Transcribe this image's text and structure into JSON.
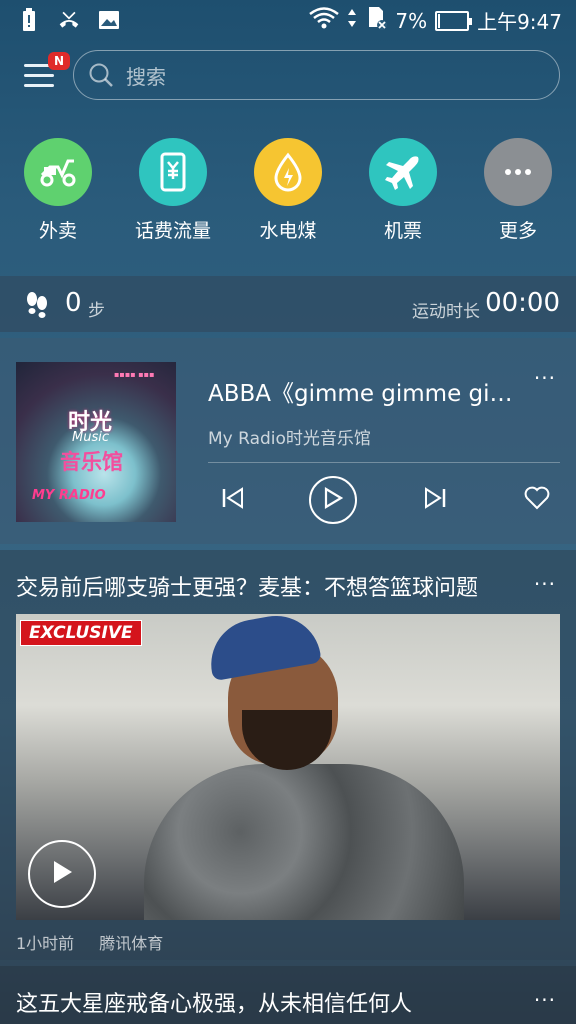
{
  "status_bar": {
    "left_icons": [
      "alert-icon",
      "missed-call-icon",
      "image-icon"
    ],
    "right_icons": [
      "wifi-icon",
      "data-arrows-icon",
      "sd-card-icon"
    ],
    "battery_percent": "7%",
    "battery_level": 0.07,
    "time": "上午9:47"
  },
  "header": {
    "menu_badge": "N",
    "search_placeholder": "搜索"
  },
  "quick_actions": [
    {
      "label": "外卖",
      "icon": "scooter-icon",
      "color": "#5fd16f"
    },
    {
      "label": "话费流量",
      "icon": "phone-yuan-icon",
      "color": "#2fc5bf"
    },
    {
      "label": "水电煤",
      "icon": "water-drop-icon",
      "color": "#f6c531"
    },
    {
      "label": "机票",
      "icon": "airplane-icon",
      "color": "#2fc5bf"
    },
    {
      "label": "更多",
      "icon": "more-icon",
      "color": "#8b8f93"
    }
  ],
  "steps": {
    "count": "0",
    "unit": "步",
    "duration_label": "运动时长",
    "duration_value": "00:00"
  },
  "music": {
    "album_title_1": "时光",
    "album_title_2": "Music",
    "album_title_3": "音乐馆",
    "album_brand": "MY RADIO",
    "song_title": "ABBA《gimme gimme gimme》",
    "artist": "My Radio时光音乐馆",
    "more": "···"
  },
  "news": [
    {
      "title": "交易前后哪支骑士更强？麦基：不想答篮球问题",
      "badge": "EXCLUSIVE",
      "time": "1小时前",
      "source": "腾讯体育",
      "more": "···"
    },
    {
      "title": "这五大星座戒备心极强，从未相信任何人",
      "more": "···"
    }
  ]
}
